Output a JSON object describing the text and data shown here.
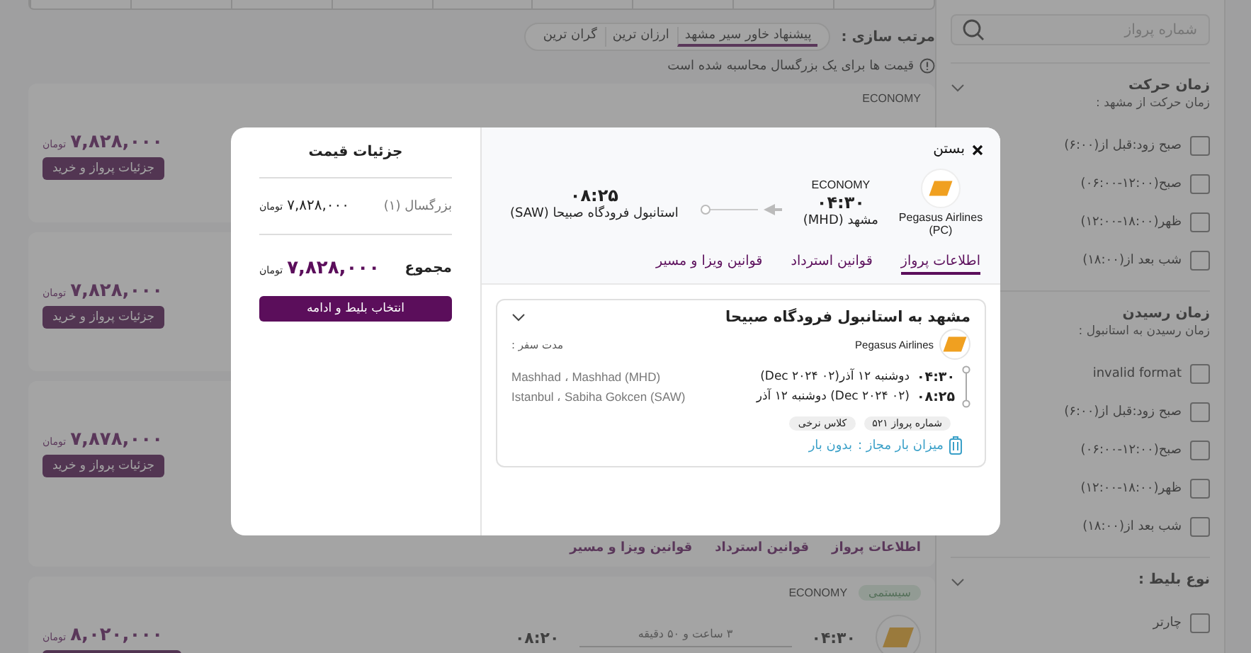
{
  "sort": {
    "label": "مرتب سازی :",
    "options": [
      {
        "label": "پیشنهاد خاور سیر مشهد",
        "selected": true
      },
      {
        "label": "ارزان ترین",
        "selected": false
      },
      {
        "label": "گران ترین",
        "selected": false
      }
    ]
  },
  "price_note": "قیمت ها برای یک بزرگسال محاسبه شده است",
  "results": [
    {
      "class_label": "ECONOMY",
      "price": "۷,۸۲۸,۰۰۰",
      "currency": "تومان",
      "button": "جزئیات پرواز و خرید"
    },
    {
      "price": "۷,۸۲۸,۰۰۰",
      "currency": "تومان",
      "button": "جزئیات پرواز و خرید"
    },
    {
      "price": "۷,۸۷۸,۰۰۰",
      "currency": "تومان",
      "button": "جزئیات پرواز و خرید",
      "tabs": [
        {
          "label": "اطلاعات پرواز",
          "selected": false
        },
        {
          "label": "قوانین استرداد",
          "selected": false
        },
        {
          "label": "قوانین ویزا و مسیر",
          "selected": false
        }
      ]
    },
    {
      "badge": "سیستمی",
      "class_label": "ECONOMY",
      "departure_time": "۰۴:۳۰",
      "duration": "۳ ساعت و ۵۰ دقیقه",
      "arrival_time": "۰۸:۲۰",
      "price": "۸,۰۲۰,۰۰۰",
      "currency": "تومان"
    }
  ],
  "sidebar": {
    "search": {
      "placeholder": "شماره پرواز"
    },
    "groups": [
      {
        "title": "زمان حرکت",
        "subtitle": "زمان حرکت از مشهد :",
        "options": [
          {
            "label": "صبح زود:قبل از(۶:۰۰)",
            "checked": false
          },
          {
            "label": "صبح(۱۲:۰۰-۰۶:۰۰)",
            "checked": false
          },
          {
            "label": "ظهر(۱۸:۰۰-۱۲:۰۰)",
            "checked": false
          },
          {
            "label": "شب بعد از(۱۸:۰۰)",
            "checked": false
          }
        ]
      },
      {
        "title": "زمان رسیدن",
        "subtitle": "زمان رسیدن به استانبول :",
        "options": [
          {
            "label": "invalid format",
            "checked": false
          },
          {
            "label": "صبح زود:قبل از(۶:۰۰)",
            "checked": false
          },
          {
            "label": "صبح(۱۲:۰۰-۰۶:۰۰)",
            "checked": false
          },
          {
            "label": "ظهر(۱۸:۰۰-۱۲:۰۰)",
            "checked": false
          },
          {
            "label": "شب بعد از(۱۸:۰۰)",
            "checked": false
          }
        ]
      },
      {
        "title": "نوع بلیط :",
        "options": [
          {
            "label": "چارتر",
            "checked": false
          }
        ]
      }
    ]
  },
  "modal": {
    "close_label": "بستن",
    "airline": "Pegasus Airlines (PC)",
    "class_label": "ECONOMY",
    "departure_time": "۰۴:۳۰",
    "departure_place": "مشهد (MHD)",
    "arrival_time": "۰۸:۲۵",
    "arrival_place": "استانبول فرودگاه صبیحا (SAW)",
    "tabs": [
      {
        "label": "اطلاعات پرواز",
        "selected": true
      },
      {
        "label": "قوانین استرداد",
        "selected": false
      },
      {
        "label": "قوانین ویزا و مسیر",
        "selected": false
      }
    ],
    "segment": {
      "title": "مشهد به استانبول فرودگاه صبیحا",
      "expanded": true,
      "airline": "Pegasus Airlines",
      "duration_label": "مدت سفر :",
      "stops": [
        {
          "time": "۰۴:۳۰",
          "date": "دوشنبه ۱۲ آذر(۰۲ Dec ۲۰۲۴)",
          "place": "Mashhad ، Mashhad (MHD)"
        },
        {
          "time": "۰۸:۲۵",
          "date": "(۰۲ Dec ۲۰۲۴) دوشنبه ۱۲ آذر",
          "place": "Istanbul ، Sabiha Gokcen (SAW)"
        }
      ],
      "chips": [
        "شماره پرواز ۵۲۱",
        "کلاس نرخی"
      ],
      "baggage_label": "میزان بار مجاز :",
      "baggage_value": "بدون بار"
    },
    "price": {
      "title": "جزئیات قیمت",
      "rows": [
        {
          "kind": "line",
          "label": "بزرگسال (۱)",
          "amount": "۷,۸۲۸,۰۰۰",
          "currency": "تومان"
        },
        {
          "kind": "total",
          "label": "مجموع",
          "amount": "۷,۸۲۸,۰۰۰",
          "currency": "تومان"
        }
      ],
      "button": "انتخاب بلیط و ادامه"
    }
  }
}
